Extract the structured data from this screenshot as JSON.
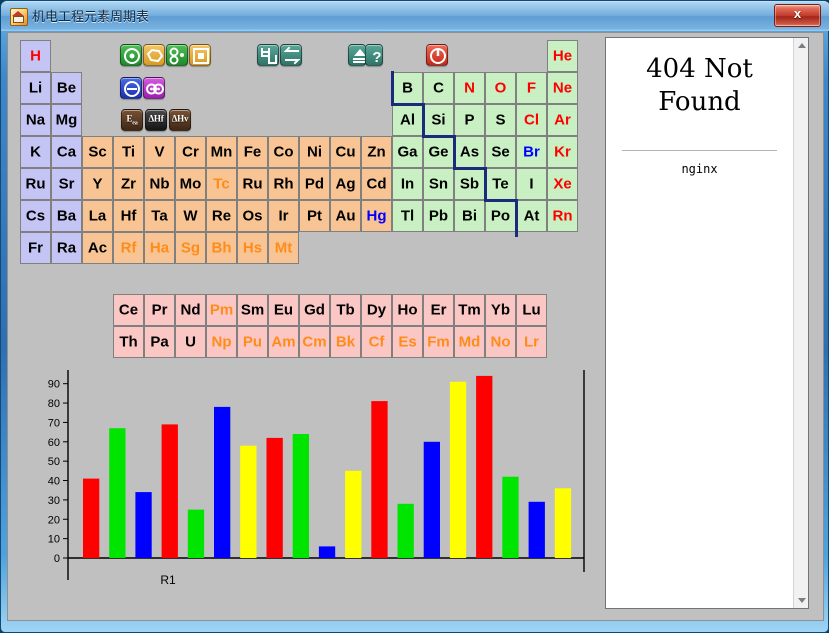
{
  "window": {
    "title": "机电工程元素周期表",
    "close_label": "x",
    "icon": "app-icon"
  },
  "toolbar": {
    "row1": [
      {
        "name": "target-circle-icon",
        "color": "#2f9e3a",
        "glyph": "target"
      },
      {
        "name": "polygon-shape-icon",
        "color": "#d79a22",
        "glyph": "polygon"
      },
      {
        "name": "molecule-icon",
        "color": "#2f9e3a",
        "glyph": "molecule"
      },
      {
        "name": "square-in-square-icon",
        "color": "#d79a22",
        "glyph": "square"
      },
      {
        "name": "bracket-chart-icon",
        "color": "#2e7467",
        "glyph": "brackets"
      },
      {
        "name": "swap-arrows-icon",
        "color": "#2e7467",
        "glyph": "swap"
      },
      {
        "name": "eject-icon",
        "color": "#2e7467",
        "glyph": "eject"
      },
      {
        "name": "help-question-icon",
        "color": "#2e7467",
        "glyph": "question"
      },
      {
        "name": "power-off-icon",
        "color": "#c32a18",
        "glyph": "power"
      }
    ],
    "row2": [
      {
        "name": "anion-circle-icon",
        "color": "#1b2fae",
        "glyph": "anion"
      },
      {
        "name": "bond-pair-icon",
        "color": "#9b1fae",
        "glyph": "bond"
      }
    ],
    "row3": [
      {
        "name": "electron-affinity-icon",
        "color": "#3f2716",
        "label": "Eea"
      },
      {
        "name": "enthalpy-fusion-icon",
        "color": "#151515",
        "label": "ΔHf"
      },
      {
        "name": "enthalpy-vapor-icon",
        "color": "#3f2716",
        "label": "ΔHv"
      }
    ]
  },
  "periodic_table": {
    "legend_colors": {
      "alkali": "#c5c5f5",
      "transition": "#f8c493",
      "nonmetal": "#c8f0c2",
      "lanthanide_actinide": "#fac7c4",
      "symbol_red": "#ff0000",
      "symbol_blue": "#0000ff",
      "symbol_orange": "#ff8c1a",
      "staircase": "#1b2a7a"
    },
    "cells": [
      {
        "s": "H",
        "col": 0,
        "row": 0,
        "g": "alkali",
        "c": "red"
      },
      {
        "s": "He",
        "col": 17,
        "row": 0,
        "g": "nonmet",
        "c": "red"
      },
      {
        "s": "Li",
        "col": 0,
        "row": 1,
        "g": "alkali",
        "c": "black"
      },
      {
        "s": "Be",
        "col": 1,
        "row": 1,
        "g": "alkali",
        "c": "black"
      },
      {
        "s": "B",
        "col": 12,
        "row": 1,
        "g": "nonmet",
        "c": "black"
      },
      {
        "s": "C",
        "col": 13,
        "row": 1,
        "g": "nonmet",
        "c": "black"
      },
      {
        "s": "N",
        "col": 14,
        "row": 1,
        "g": "nonmet",
        "c": "red"
      },
      {
        "s": "O",
        "col": 15,
        "row": 1,
        "g": "nonmet",
        "c": "red"
      },
      {
        "s": "F",
        "col": 16,
        "row": 1,
        "g": "nonmet",
        "c": "red"
      },
      {
        "s": "Ne",
        "col": 17,
        "row": 1,
        "g": "nonmet",
        "c": "red"
      },
      {
        "s": "Na",
        "col": 0,
        "row": 2,
        "g": "alkali",
        "c": "black"
      },
      {
        "s": "Mg",
        "col": 1,
        "row": 2,
        "g": "alkali",
        "c": "black"
      },
      {
        "s": "Al",
        "col": 12,
        "row": 2,
        "g": "nonmet",
        "c": "black"
      },
      {
        "s": "Si",
        "col": 13,
        "row": 2,
        "g": "nonmet",
        "c": "black"
      },
      {
        "s": "P",
        "col": 14,
        "row": 2,
        "g": "nonmet",
        "c": "black"
      },
      {
        "s": "S",
        "col": 15,
        "row": 2,
        "g": "nonmet",
        "c": "black"
      },
      {
        "s": "Cl",
        "col": 16,
        "row": 2,
        "g": "nonmet",
        "c": "red"
      },
      {
        "s": "Ar",
        "col": 17,
        "row": 2,
        "g": "nonmet",
        "c": "red"
      },
      {
        "s": "K",
        "col": 0,
        "row": 3,
        "g": "alkali",
        "c": "black"
      },
      {
        "s": "Ca",
        "col": 1,
        "row": 3,
        "g": "alkali",
        "c": "black"
      },
      {
        "s": "Sc",
        "col": 2,
        "row": 3,
        "g": "trans",
        "c": "black"
      },
      {
        "s": "Ti",
        "col": 3,
        "row": 3,
        "g": "trans",
        "c": "black"
      },
      {
        "s": "V",
        "col": 4,
        "row": 3,
        "g": "trans",
        "c": "black"
      },
      {
        "s": "Cr",
        "col": 5,
        "row": 3,
        "g": "trans",
        "c": "black"
      },
      {
        "s": "Mn",
        "col": 6,
        "row": 3,
        "g": "trans",
        "c": "black"
      },
      {
        "s": "Fe",
        "col": 7,
        "row": 3,
        "g": "trans",
        "c": "black"
      },
      {
        "s": "Co",
        "col": 8,
        "row": 3,
        "g": "trans",
        "c": "black"
      },
      {
        "s": "Ni",
        "col": 9,
        "row": 3,
        "g": "trans",
        "c": "black"
      },
      {
        "s": "Cu",
        "col": 10,
        "row": 3,
        "g": "trans",
        "c": "black"
      },
      {
        "s": "Zn",
        "col": 11,
        "row": 3,
        "g": "trans",
        "c": "black"
      },
      {
        "s": "Ga",
        "col": 12,
        "row": 3,
        "g": "nonmet",
        "c": "black"
      },
      {
        "s": "Ge",
        "col": 13,
        "row": 3,
        "g": "nonmet",
        "c": "black"
      },
      {
        "s": "As",
        "col": 14,
        "row": 3,
        "g": "nonmet",
        "c": "black"
      },
      {
        "s": "Se",
        "col": 15,
        "row": 3,
        "g": "nonmet",
        "c": "black"
      },
      {
        "s": "Br",
        "col": 16,
        "row": 3,
        "g": "nonmet",
        "c": "blue"
      },
      {
        "s": "Kr",
        "col": 17,
        "row": 3,
        "g": "nonmet",
        "c": "red"
      },
      {
        "s": "Ru",
        "col": 0,
        "row": 4,
        "g": "alkali",
        "c": "black"
      },
      {
        "s": "Sr",
        "col": 1,
        "row": 4,
        "g": "alkali",
        "c": "black"
      },
      {
        "s": "Y",
        "col": 2,
        "row": 4,
        "g": "trans",
        "c": "black"
      },
      {
        "s": "Zr",
        "col": 3,
        "row": 4,
        "g": "trans",
        "c": "black"
      },
      {
        "s": "Nb",
        "col": 4,
        "row": 4,
        "g": "trans",
        "c": "black"
      },
      {
        "s": "Mo",
        "col": 5,
        "row": 4,
        "g": "trans",
        "c": "black"
      },
      {
        "s": "Tc",
        "col": 6,
        "row": 4,
        "g": "trans",
        "c": "orange"
      },
      {
        "s": "Ru",
        "col": 7,
        "row": 4,
        "g": "trans",
        "c": "black"
      },
      {
        "s": "Rh",
        "col": 8,
        "row": 4,
        "g": "trans",
        "c": "black"
      },
      {
        "s": "Pd",
        "col": 9,
        "row": 4,
        "g": "trans",
        "c": "black"
      },
      {
        "s": "Ag",
        "col": 10,
        "row": 4,
        "g": "trans",
        "c": "black"
      },
      {
        "s": "Cd",
        "col": 11,
        "row": 4,
        "g": "trans",
        "c": "black"
      },
      {
        "s": "In",
        "col": 12,
        "row": 4,
        "g": "nonmet",
        "c": "black"
      },
      {
        "s": "Sn",
        "col": 13,
        "row": 4,
        "g": "nonmet",
        "c": "black"
      },
      {
        "s": "Sb",
        "col": 14,
        "row": 4,
        "g": "nonmet",
        "c": "black"
      },
      {
        "s": "Te",
        "col": 15,
        "row": 4,
        "g": "nonmet",
        "c": "black"
      },
      {
        "s": "I",
        "col": 16,
        "row": 4,
        "g": "nonmet",
        "c": "black"
      },
      {
        "s": "Xe",
        "col": 17,
        "row": 4,
        "g": "nonmet",
        "c": "red"
      },
      {
        "s": "Cs",
        "col": 0,
        "row": 5,
        "g": "alkali",
        "c": "black"
      },
      {
        "s": "Ba",
        "col": 1,
        "row": 5,
        "g": "alkali",
        "c": "black"
      },
      {
        "s": "La",
        "col": 2,
        "row": 5,
        "g": "trans",
        "c": "black"
      },
      {
        "s": "Hf",
        "col": 3,
        "row": 5,
        "g": "trans",
        "c": "black"
      },
      {
        "s": "Ta",
        "col": 4,
        "row": 5,
        "g": "trans",
        "c": "black"
      },
      {
        "s": "W",
        "col": 5,
        "row": 5,
        "g": "trans",
        "c": "black"
      },
      {
        "s": "Re",
        "col": 6,
        "row": 5,
        "g": "trans",
        "c": "black"
      },
      {
        "s": "Os",
        "col": 7,
        "row": 5,
        "g": "trans",
        "c": "black"
      },
      {
        "s": "Ir",
        "col": 8,
        "row": 5,
        "g": "trans",
        "c": "black"
      },
      {
        "s": "Pt",
        "col": 9,
        "row": 5,
        "g": "trans",
        "c": "black"
      },
      {
        "s": "Au",
        "col": 10,
        "row": 5,
        "g": "trans",
        "c": "black"
      },
      {
        "s": "Hg",
        "col": 11,
        "row": 5,
        "g": "trans",
        "c": "blue"
      },
      {
        "s": "Tl",
        "col": 12,
        "row": 5,
        "g": "nonmet",
        "c": "black"
      },
      {
        "s": "Pb",
        "col": 13,
        "row": 5,
        "g": "nonmet",
        "c": "black"
      },
      {
        "s": "Bi",
        "col": 14,
        "row": 5,
        "g": "nonmet",
        "c": "black"
      },
      {
        "s": "Po",
        "col": 15,
        "row": 5,
        "g": "nonmet",
        "c": "black"
      },
      {
        "s": "At",
        "col": 16,
        "row": 5,
        "g": "nonmet",
        "c": "black"
      },
      {
        "s": "Rn",
        "col": 17,
        "row": 5,
        "g": "nonmet",
        "c": "red"
      },
      {
        "s": "Fr",
        "col": 0,
        "row": 6,
        "g": "alkali",
        "c": "black"
      },
      {
        "s": "Ra",
        "col": 1,
        "row": 6,
        "g": "alkali",
        "c": "black"
      },
      {
        "s": "Ac",
        "col": 2,
        "row": 6,
        "g": "trans",
        "c": "black"
      },
      {
        "s": "Rf",
        "col": 3,
        "row": 6,
        "g": "trans",
        "c": "orange"
      },
      {
        "s": "Ha",
        "col": 4,
        "row": 6,
        "g": "trans",
        "c": "orange"
      },
      {
        "s": "Sg",
        "col": 5,
        "row": 6,
        "g": "trans",
        "c": "orange"
      },
      {
        "s": "Bh",
        "col": 6,
        "row": 6,
        "g": "trans",
        "c": "orange"
      },
      {
        "s": "Hs",
        "col": 7,
        "row": 6,
        "g": "trans",
        "c": "orange"
      },
      {
        "s": "Mt",
        "col": 8,
        "row": 6,
        "g": "trans",
        "c": "orange"
      }
    ],
    "lanthanides": [
      {
        "s": "Ce",
        "c": "black"
      },
      {
        "s": "Pr",
        "c": "black"
      },
      {
        "s": "Nd",
        "c": "black"
      },
      {
        "s": "Pm",
        "c": "orange"
      },
      {
        "s": "Sm",
        "c": "black"
      },
      {
        "s": "Eu",
        "c": "black"
      },
      {
        "s": "Gd",
        "c": "black"
      },
      {
        "s": "Tb",
        "c": "black"
      },
      {
        "s": "Dy",
        "c": "black"
      },
      {
        "s": "Ho",
        "c": "black"
      },
      {
        "s": "Er",
        "c": "black"
      },
      {
        "s": "Tm",
        "c": "black"
      },
      {
        "s": "Yb",
        "c": "black"
      },
      {
        "s": "Lu",
        "c": "black"
      }
    ],
    "actinides": [
      {
        "s": "Th",
        "c": "black"
      },
      {
        "s": "Pa",
        "c": "black"
      },
      {
        "s": "U",
        "c": "black"
      },
      {
        "s": "Np",
        "c": "orange"
      },
      {
        "s": "Pu",
        "c": "orange"
      },
      {
        "s": "Am",
        "c": "orange"
      },
      {
        "s": "Cm",
        "c": "orange"
      },
      {
        "s": "Bk",
        "c": "orange"
      },
      {
        "s": "Cf",
        "c": "orange"
      },
      {
        "s": "Es",
        "c": "orange"
      },
      {
        "s": "Fm",
        "c": "orange"
      },
      {
        "s": "Md",
        "c": "orange"
      },
      {
        "s": "No",
        "c": "orange"
      },
      {
        "s": "Lr",
        "c": "orange"
      }
    ]
  },
  "chart_data": {
    "type": "bar",
    "title": "",
    "xlabel": "",
    "ylabel": "",
    "ylim": [
      0,
      95
    ],
    "yticks": [
      0,
      10,
      20,
      30,
      40,
      50,
      60,
      70,
      80,
      90
    ],
    "grid": false,
    "legend": "none",
    "categories": [
      "R1"
    ],
    "category_label_x": 100,
    "colors": {
      "red": "#ff0000",
      "green": "#00e500",
      "blue": "#0000ff",
      "yellow": "#ffff00"
    },
    "bars": [
      {
        "value": 41,
        "color": "red"
      },
      {
        "value": 67,
        "color": "green"
      },
      {
        "value": 34,
        "color": "blue"
      },
      {
        "value": 69,
        "color": "red"
      },
      {
        "value": 25,
        "color": "green"
      },
      {
        "value": 78,
        "color": "blue"
      },
      {
        "value": 58,
        "color": "yellow"
      },
      {
        "value": 62,
        "color": "red"
      },
      {
        "value": 64,
        "color": "green"
      },
      {
        "value": 6,
        "color": "blue"
      },
      {
        "value": 45,
        "color": "yellow"
      },
      {
        "value": 81,
        "color": "red"
      },
      {
        "value": 28,
        "color": "green"
      },
      {
        "value": 60,
        "color": "blue"
      },
      {
        "value": 91,
        "color": "yellow"
      },
      {
        "value": 94,
        "color": "red"
      },
      {
        "value": 42,
        "color": "green"
      },
      {
        "value": 29,
        "color": "blue"
      },
      {
        "value": 36,
        "color": "yellow"
      }
    ]
  },
  "browser_panel": {
    "error_title": "404 Not Found",
    "server": "nginx",
    "scroll_up": "▲",
    "scroll_down": "▼"
  }
}
